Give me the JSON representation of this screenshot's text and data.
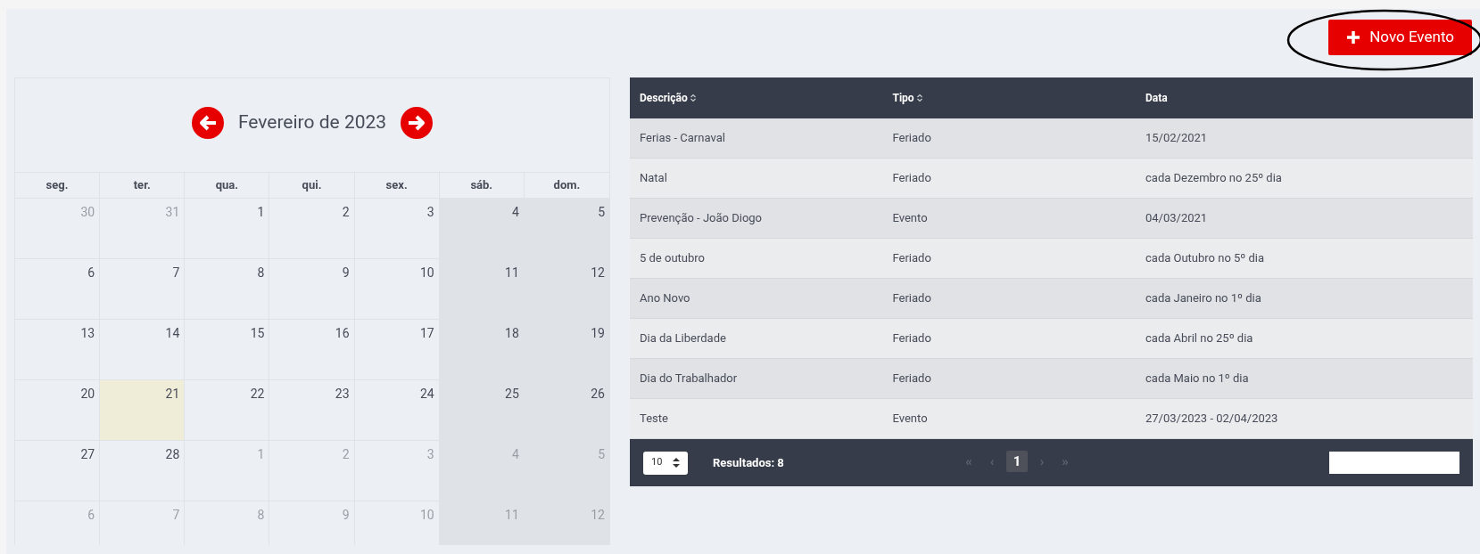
{
  "new_event_button": {
    "label": "Novo Evento"
  },
  "calendar": {
    "title": "Fevereiro de 2023",
    "weekdays": [
      {
        "label": "seg.",
        "weekend": false
      },
      {
        "label": "ter.",
        "weekend": false
      },
      {
        "label": "qua.",
        "weekend": false
      },
      {
        "label": "qui.",
        "weekend": false
      },
      {
        "label": "sex.",
        "weekend": false
      },
      {
        "label": "sáb.",
        "weekend": true
      },
      {
        "label": "dom.",
        "weekend": true
      }
    ],
    "weeks": [
      [
        {
          "day": "30",
          "other_month": true,
          "today": false
        },
        {
          "day": "31",
          "other_month": true,
          "today": false
        },
        {
          "day": "1",
          "other_month": false,
          "today": false
        },
        {
          "day": "2",
          "other_month": false,
          "today": false
        },
        {
          "day": "3",
          "other_month": false,
          "today": false
        },
        {
          "day": "4",
          "other_month": false,
          "today": false
        },
        {
          "day": "5",
          "other_month": false,
          "today": false
        }
      ],
      [
        {
          "day": "6",
          "other_month": false,
          "today": false
        },
        {
          "day": "7",
          "other_month": false,
          "today": false
        },
        {
          "day": "8",
          "other_month": false,
          "today": false
        },
        {
          "day": "9",
          "other_month": false,
          "today": false
        },
        {
          "day": "10",
          "other_month": false,
          "today": false
        },
        {
          "day": "11",
          "other_month": false,
          "today": false
        },
        {
          "day": "12",
          "other_month": false,
          "today": false
        }
      ],
      [
        {
          "day": "13",
          "other_month": false,
          "today": false
        },
        {
          "day": "14",
          "other_month": false,
          "today": false
        },
        {
          "day": "15",
          "other_month": false,
          "today": false
        },
        {
          "day": "16",
          "other_month": false,
          "today": false
        },
        {
          "day": "17",
          "other_month": false,
          "today": false
        },
        {
          "day": "18",
          "other_month": false,
          "today": false
        },
        {
          "day": "19",
          "other_month": false,
          "today": false
        }
      ],
      [
        {
          "day": "20",
          "other_month": false,
          "today": false
        },
        {
          "day": "21",
          "other_month": false,
          "today": true
        },
        {
          "day": "22",
          "other_month": false,
          "today": false
        },
        {
          "day": "23",
          "other_month": false,
          "today": false
        },
        {
          "day": "24",
          "other_month": false,
          "today": false
        },
        {
          "day": "25",
          "other_month": false,
          "today": false
        },
        {
          "day": "26",
          "other_month": false,
          "today": false
        }
      ],
      [
        {
          "day": "27",
          "other_month": false,
          "today": false
        },
        {
          "day": "28",
          "other_month": false,
          "today": false
        },
        {
          "day": "1",
          "other_month": true,
          "today": false
        },
        {
          "day": "2",
          "other_month": true,
          "today": false
        },
        {
          "day": "3",
          "other_month": true,
          "today": false
        },
        {
          "day": "4",
          "other_month": true,
          "today": false
        },
        {
          "day": "5",
          "other_month": true,
          "today": false
        }
      ],
      [
        {
          "day": "6",
          "other_month": true,
          "today": false
        },
        {
          "day": "7",
          "other_month": true,
          "today": false
        },
        {
          "day": "8",
          "other_month": true,
          "today": false
        },
        {
          "day": "9",
          "other_month": true,
          "today": false
        },
        {
          "day": "10",
          "other_month": true,
          "today": false
        },
        {
          "day": "11",
          "other_month": true,
          "today": false
        },
        {
          "day": "12",
          "other_month": true,
          "today": false
        }
      ]
    ]
  },
  "table": {
    "columns": [
      {
        "label": "Descrição",
        "sortable": true
      },
      {
        "label": "Tipo",
        "sortable": true
      },
      {
        "label": "Data",
        "sortable": false
      }
    ],
    "rows": [
      [
        "Ferias - Carnaval",
        "Feriado",
        "15/02/2021"
      ],
      [
        "Natal",
        "Feriado",
        "cada Dezembro no 25º dia"
      ],
      [
        "Prevenção - João Diogo",
        "Evento",
        "04/03/2021"
      ],
      [
        "5 de outubro",
        "Feriado",
        "cada Outubro no 5º dia"
      ],
      [
        "Ano Novo",
        "Feriado",
        "cada Janeiro no 1º dia"
      ],
      [
        "Dia da Liberdade",
        "Feriado",
        "cada Abril no 25º dia"
      ],
      [
        "Dia do Trabalhador",
        "Feriado",
        "cada Maio no 1º dia"
      ],
      [
        "Teste",
        "Evento",
        "27/03/2023 - 02/04/2023"
      ]
    ]
  },
  "footer": {
    "page_size": "10",
    "results": "Resultados: 8",
    "pagination": [
      {
        "label": "«",
        "kind": "nav",
        "selected": false
      },
      {
        "label": "‹",
        "kind": "nav",
        "selected": false
      },
      {
        "label": "1",
        "kind": "page",
        "selected": true
      },
      {
        "label": "›",
        "kind": "nav",
        "selected": false
      },
      {
        "label": "»",
        "kind": "nav",
        "selected": false
      }
    ]
  }
}
